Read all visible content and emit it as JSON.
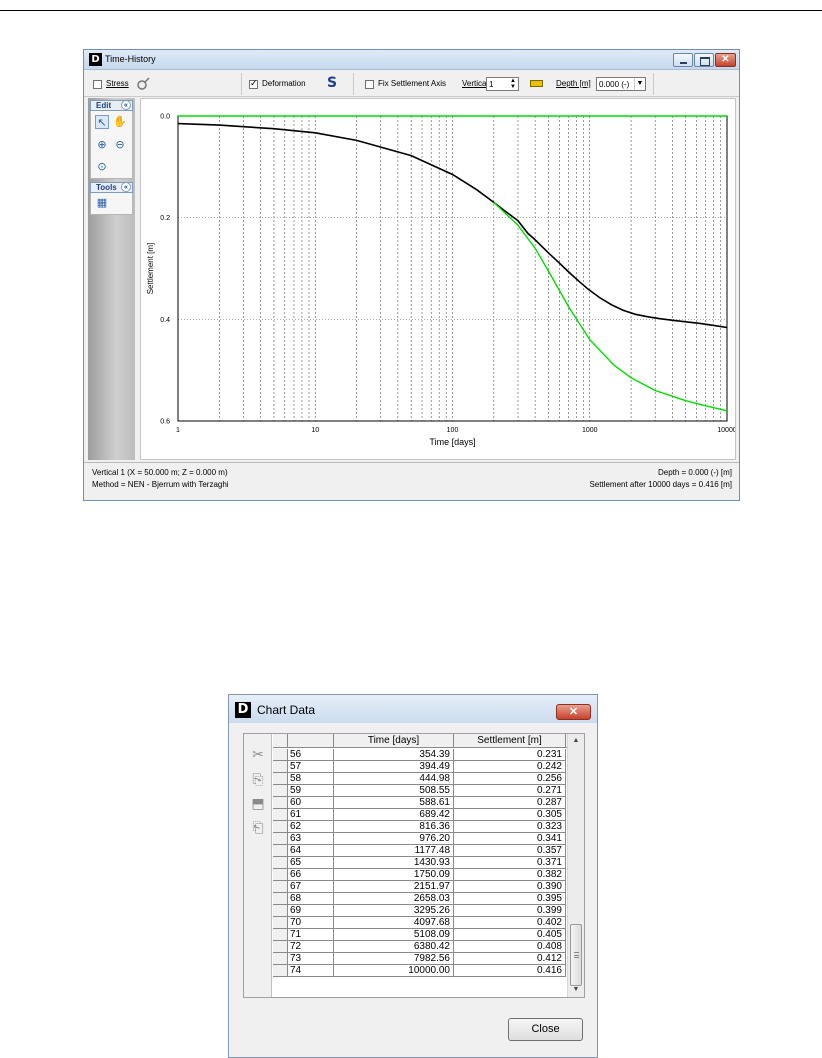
{
  "time_history_window": {
    "title": "Time-History",
    "toolbar": {
      "stress_label": "Stress",
      "stress_checked": false,
      "deformation_label": "Deformation",
      "deformation_checked": true,
      "s_button_label": "S",
      "fix_settlement_label": "Fix Settlement Axis",
      "fix_settlement_checked": false,
      "vertical_label": "Vertical",
      "vertical_value": "1",
      "depth_label": "Depth [m]",
      "depth_value": "0.000 (-)",
      "icons": [
        "stress-probe-icon",
        "ruler-icon",
        "dropdown-arrow-icon",
        "spinner-arrows-icon"
      ]
    },
    "sidebar": {
      "edit_title": "Edit",
      "tools_title": "Tools",
      "edit_icons": [
        "select-arrow-icon",
        "pan-hand-icon",
        "zoom-in-icon",
        "zoom-out-icon",
        "zoom-fit-icon"
      ],
      "tools_icons": [
        "chart-data-table-icon"
      ]
    },
    "status": {
      "line1_left": "Vertical 1 (X = 50.000 m; Z = 0.000 m)",
      "line2_left": "Method = NEN - Bjerrum with Terzaghi",
      "line1_right": "Depth = 0.000 (-) [m]",
      "line2_right": "Settlement after 10000 days = 0.416 [m]"
    }
  },
  "chart_data": {
    "type": "line",
    "xlabel": "Time [days]",
    "ylabel": "Settlement [m]",
    "x_scale": "log",
    "xlim": [
      1,
      10000
    ],
    "ylim": [
      0.0,
      0.6
    ],
    "y_inverted": true,
    "x_ticks": [
      "1",
      "10",
      "100",
      "1000",
      "10000"
    ],
    "y_ticks": [
      "0.0",
      "0.2",
      "0.4",
      "0.6"
    ],
    "grid": true,
    "colors": {
      "green_series": "#00dd00",
      "black_series": "#000000"
    },
    "series": [
      {
        "color": "#00dd00",
        "x": [
          1,
          10000
        ],
        "y": [
          0.0,
          0.0
        ]
      },
      {
        "color": "#000000",
        "x": [
          1,
          2,
          5,
          10,
          20,
          50,
          100,
          150,
          200,
          250,
          300,
          354.39,
          394.49,
          444.98,
          508.55,
          588.61,
          689.42,
          816.36,
          976.2,
          1177.48,
          1430.93,
          1750.09,
          2151.97,
          2658.03,
          3295.26,
          4097.68,
          5108.09,
          6380.42,
          7982.56,
          10000
        ],
        "y": [
          0.015,
          0.018,
          0.025,
          0.033,
          0.048,
          0.078,
          0.115,
          0.145,
          0.17,
          0.19,
          0.206,
          0.231,
          0.242,
          0.256,
          0.271,
          0.287,
          0.305,
          0.323,
          0.341,
          0.357,
          0.371,
          0.382,
          0.39,
          0.395,
          0.399,
          0.402,
          0.405,
          0.408,
          0.412,
          0.416
        ]
      },
      {
        "color": "#00dd00",
        "x": [
          200,
          300,
          400,
          500,
          700,
          1000,
          1500,
          2000,
          3000,
          5000,
          7000,
          10000
        ],
        "y": [
          0.17,
          0.215,
          0.26,
          0.305,
          0.375,
          0.44,
          0.49,
          0.515,
          0.54,
          0.56,
          0.57,
          0.58
        ]
      }
    ]
  },
  "chart_data_window": {
    "title": "Chart Data",
    "columns": [
      "",
      "Time [days]",
      "Settlement [m]"
    ],
    "rows": [
      [
        "56",
        "354.39",
        "0.231"
      ],
      [
        "57",
        "394.49",
        "0.242"
      ],
      [
        "58",
        "444.98",
        "0.256"
      ],
      [
        "59",
        "508.55",
        "0.271"
      ],
      [
        "60",
        "588.61",
        "0.287"
      ],
      [
        "61",
        "689.42",
        "0.305"
      ],
      [
        "62",
        "816.36",
        "0.323"
      ],
      [
        "63",
        "976.20",
        "0.341"
      ],
      [
        "64",
        "1177.48",
        "0.357"
      ],
      [
        "65",
        "1430.93",
        "0.371"
      ],
      [
        "66",
        "1750.09",
        "0.382"
      ],
      [
        "67",
        "2151.97",
        "0.390"
      ],
      [
        "68",
        "2658.03",
        "0.395"
      ],
      [
        "69",
        "3295.26",
        "0.399"
      ],
      [
        "70",
        "4097.68",
        "0.402"
      ],
      [
        "71",
        "5108.09",
        "0.405"
      ],
      [
        "72",
        "6380.42",
        "0.408"
      ],
      [
        "73",
        "7982.56",
        "0.412"
      ],
      [
        "74",
        "10000.00",
        "0.416"
      ]
    ],
    "tool_icons": [
      "cut-icon",
      "copy-icon",
      "insert-row-icon",
      "paste-icon"
    ],
    "close_label": "Close"
  }
}
